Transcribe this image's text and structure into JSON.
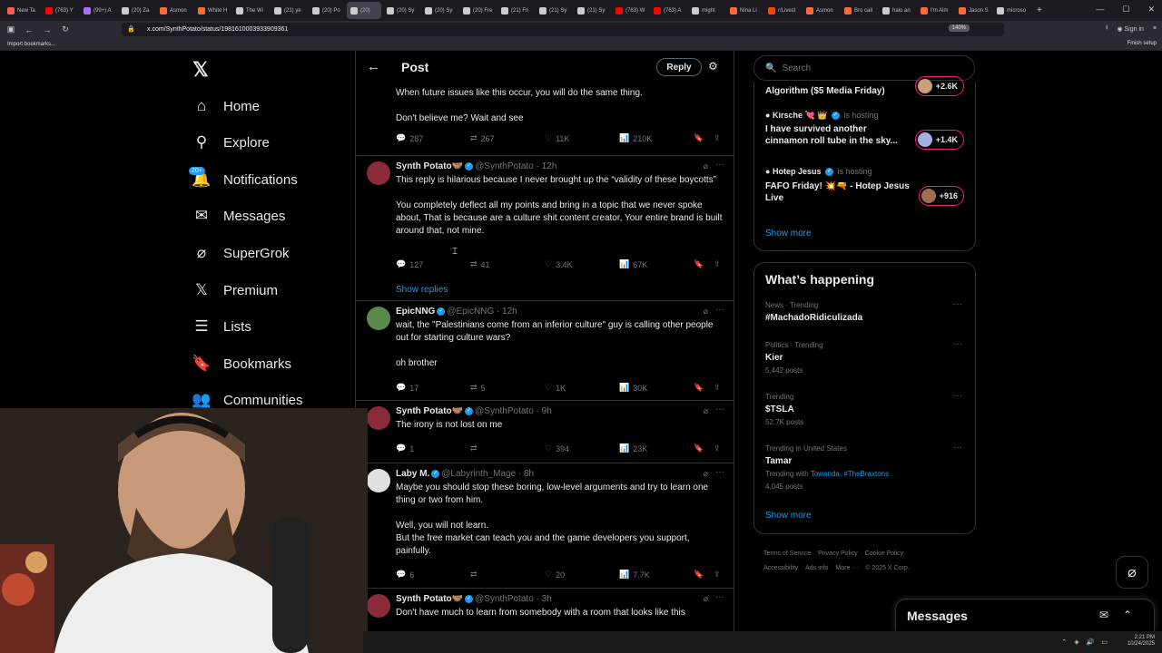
{
  "browser": {
    "tabs": [
      {
        "label": "New Ta",
        "color": "#ff5a5a"
      },
      {
        "label": "(763) Y",
        "color": "#ff0000"
      },
      {
        "label": "(99+) A",
        "color": "#a970ff"
      },
      {
        "label": "(20) Za",
        "color": "#cccccc"
      },
      {
        "label": "Asmon",
        "color": "#ff6b35"
      },
      {
        "label": "White H",
        "color": "#ff6b35"
      },
      {
        "label": "The Wi",
        "color": "#cccccc"
      },
      {
        "label": "(21) ye",
        "color": "#cccccc"
      },
      {
        "label": "(20) Po",
        "color": "#cccccc"
      },
      {
        "label": "(20)",
        "color": "#cccccc"
      },
      {
        "label": "(20) Sy",
        "color": "#cccccc"
      },
      {
        "label": "(20) Sy",
        "color": "#cccccc"
      },
      {
        "label": "(20) Fre",
        "color": "#cccccc"
      },
      {
        "label": "(21) Fri",
        "color": "#cccccc"
      },
      {
        "label": "(21) Sy",
        "color": "#cccccc"
      },
      {
        "label": "(21) Sy",
        "color": "#cccccc"
      },
      {
        "label": "(763) W",
        "color": "#ff0000"
      },
      {
        "label": "(763) A",
        "color": "#ff0000"
      },
      {
        "label": "might",
        "color": "#cccccc"
      },
      {
        "label": "Nina Li",
        "color": "#ff6b35"
      },
      {
        "label": "r/Livest",
        "color": "#ff4500"
      },
      {
        "label": "Asmon",
        "color": "#ff6b35"
      },
      {
        "label": "Bro call",
        "color": "#ff6b35"
      },
      {
        "label": "halo an",
        "color": "#cccccc"
      },
      {
        "label": "I'm Alm",
        "color": "#ff6b35"
      },
      {
        "label": "Jason S",
        "color": "#ff6b35"
      },
      {
        "label": "microso",
        "color": "#cccccc"
      }
    ],
    "active_tab_index": 9,
    "url": "x.com/SynthPotato/status/1981610003933909361",
    "zoom": "140%",
    "sign_in": "Sign in",
    "import_bookmarks": "Import bookmarks...",
    "finish_setup": "Finish setup"
  },
  "nav": {
    "items": [
      {
        "label": "Home",
        "icon": "home-icon"
      },
      {
        "label": "Explore",
        "icon": "search-icon"
      },
      {
        "label": "Notifications",
        "icon": "bell-icon"
      },
      {
        "label": "Messages",
        "icon": "mail-icon"
      },
      {
        "label": "SuperGrok",
        "icon": "grok-icon"
      },
      {
        "label": "Premium",
        "icon": "x-icon"
      },
      {
        "label": "Lists",
        "icon": "list-icon"
      },
      {
        "label": "Bookmarks",
        "icon": "bookmark-icon"
      },
      {
        "label": "Communities",
        "icon": "communities-icon"
      }
    ],
    "notifications_badge": "20+"
  },
  "header": {
    "title": "Post",
    "reply_label": "Reply"
  },
  "top_fragment": {
    "text": "When future issues like this occur, you will do the same thing.\n\nDon't believe me? Wait and see",
    "replies": "287",
    "reposts": "267",
    "likes": "11K",
    "views": "210K"
  },
  "tweets": [
    {
      "name": "Synth Potato🤝🏽",
      "handle": "@SynthPotato",
      "time": "· 12h",
      "text": "This reply is hilarious because I never brought up the “validity of these boycotts”\n\nYou completely deflect all my points and bring in a topic that we never spoke about, That is because are a culture shit content creator, Your entire brand is built around that, not mine.",
      "replies": "127",
      "reposts": "41",
      "likes": "3.4K",
      "views": "67K",
      "show_replies": "Show replies",
      "avatar_color": "#8a2a3a"
    },
    {
      "name": "EpicNNG",
      "handle": "@EpicNNG",
      "time": "· 12h",
      "text": "wait, the \"Palestinians come from an inferior culture\" guy is calling other people out for starting culture wars?\n\noh brother",
      "replies": "17",
      "reposts": "5",
      "likes": "1K",
      "views": "30K",
      "avatar_color": "#5a8a4a"
    },
    {
      "name": "Synth Potato🤝🏽",
      "handle": "@SynthPotato",
      "time": "· 9h",
      "text": "The irony is not lost on me",
      "replies": "1",
      "reposts": "",
      "likes": "394",
      "views": "23K",
      "avatar_color": "#8a2a3a"
    },
    {
      "name": "Laby M.",
      "handle": "@Labyrinth_Mage",
      "time": "· 8h",
      "text": "Maybe you should stop these boring, low-level arguments and try to learn one thing or two from him.\n\nWell, you will not learn.\nBut the free market can teach you and the game developers you support, painfully.",
      "replies": "6",
      "reposts": "",
      "likes": "20",
      "views": "7.7K",
      "avatar_color": "#e0e0e0"
    },
    {
      "name": "Synth Potato🤝🏽",
      "handle": "@SynthPotato",
      "time": "· 3h",
      "text": "Don't have much to learn from somebody with a room that looks like this",
      "avatar_color": "#8a2a3a"
    }
  ],
  "search": {
    "placeholder": "Search"
  },
  "spaces": {
    "partial_title": "Algorithm ($5 Media Friday)",
    "partial_count": "+2.6K",
    "items": [
      {
        "host": "Kirsche 💘 👑",
        "status": "is hosting",
        "title": "I have survived another cinnamon roll tube in the sky...",
        "count": "+1.4K"
      },
      {
        "host": "Hotep Jesus",
        "status": "is hosting",
        "title": "FAFO Friday! 💥🔫 - Hotep Jesus Live",
        "count": "+916"
      }
    ],
    "show_more": "Show more"
  },
  "trends": {
    "title": "What’s happening",
    "items": [
      {
        "meta": "News · Trending",
        "name": "#MachadoRidiculizada",
        "posts": ""
      },
      {
        "meta": "Politics · Trending",
        "name": "Kier",
        "posts": "5,442 posts"
      },
      {
        "meta": "Trending",
        "name": "$TSLA",
        "posts": "52.7K posts"
      },
      {
        "meta": "Trending in United States",
        "name": "Tamar",
        "with_label": "Trending with",
        "with_links": "Towanda, #TheBraxtons",
        "posts": "4,045 posts"
      }
    ],
    "show_more": "Show more"
  },
  "footer": {
    "links": [
      "Terms of Service",
      "Privacy Policy",
      "Cookie Policy",
      "Accessibility",
      "Ads info",
      "More ···",
      "© 2025 X Corp."
    ]
  },
  "messages_drawer": {
    "title": "Messages"
  },
  "taskbar": {
    "time": "2:21 PM",
    "date": "10/24/2025"
  }
}
